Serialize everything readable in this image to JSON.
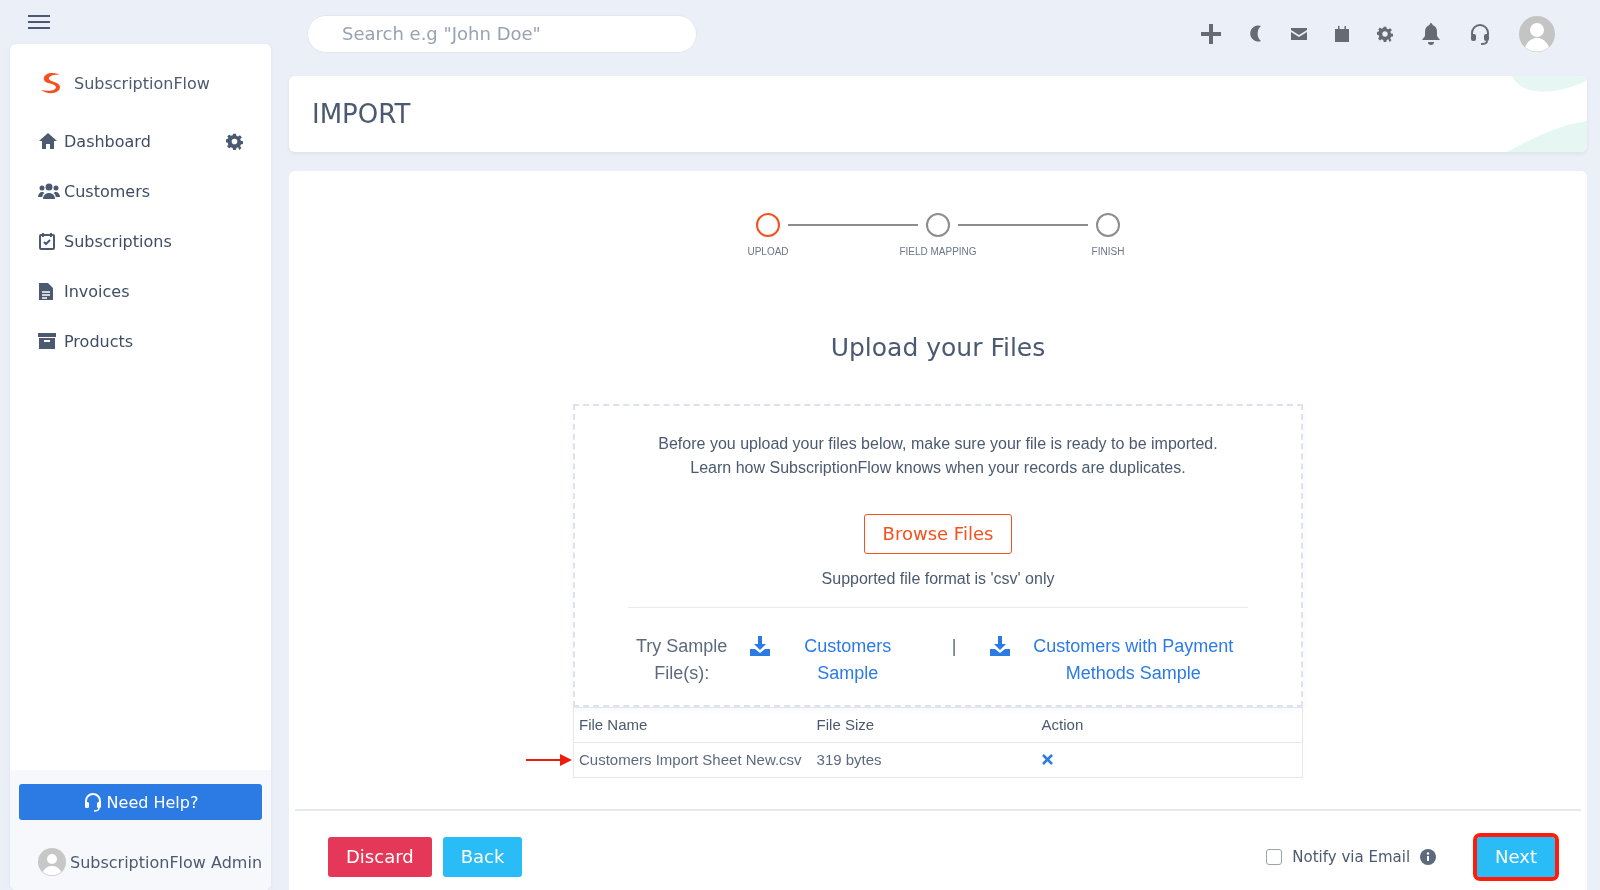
{
  "header": {
    "search": {
      "placeholder": "Search e.g \"John Doe\""
    }
  },
  "sidebar": {
    "brand": "SubscriptionFlow",
    "items": [
      {
        "label": "Dashboard",
        "has_settings": true
      },
      {
        "label": "Customers",
        "has_settings": false
      },
      {
        "label": "Subscriptions",
        "has_settings": false
      },
      {
        "label": "Invoices",
        "has_settings": false
      },
      {
        "label": "Products",
        "has_settings": false
      }
    ],
    "help_button": "Need Help?",
    "user": "SubscriptionFlow Admin"
  },
  "page": {
    "title": "IMPORT"
  },
  "steps": [
    {
      "label": "UPLOAD",
      "selected": true
    },
    {
      "label": "FIELD MAPPING",
      "selected": false
    },
    {
      "label": "FINISH",
      "selected": false
    }
  ],
  "upload": {
    "heading": "Upload your Files",
    "intro": [
      "Before you upload your files below, make sure your file is ready to be imported.",
      "Learn how SubscriptionFlow knows when your records are duplicates."
    ],
    "browse_button": "Browse Files",
    "format_note": "Supported file format is 'csv' only",
    "sample_label": "Try Sample File(s):",
    "separator": "|",
    "samples": [
      "Customers Sample",
      "Customers with Payment Methods Sample"
    ]
  },
  "table": {
    "columns": [
      "File Name",
      "File Size",
      "Action"
    ],
    "rows": [
      {
        "file_name": "Customers Import Sheet New.csv",
        "file_size": "319 bytes",
        "pointed": true
      }
    ]
  },
  "footer": {
    "discard": "Discard",
    "back": "Back",
    "notify": {
      "label": "Notify via Email",
      "checked": false
    },
    "next": {
      "label": "Next",
      "highlighted": true
    }
  }
}
